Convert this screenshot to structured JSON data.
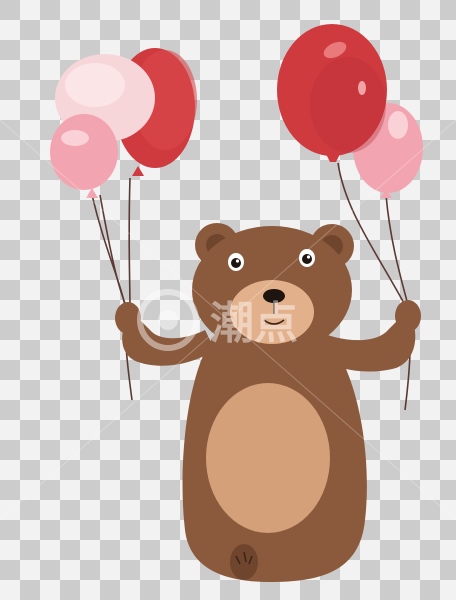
{
  "image": {
    "subject": "bear-holding-balloons",
    "background": "transparency-checkerboard",
    "watermark_text": "潮点"
  },
  "colors": {
    "checker_light": "#f2f2f2",
    "checker_dark": "#cccccc",
    "bear_fur": "#8b5a3c",
    "bear_fur_dark": "#6f452d",
    "bear_belly": "#d4a07a",
    "bear_muzzle": "#e2b08a",
    "balloon_red": "#cf3a3e",
    "balloon_red_dark": "#a82a30",
    "balloon_pink": "#f2a5b0",
    "balloon_white": "#f7d6da",
    "string": "#5a3a32"
  }
}
